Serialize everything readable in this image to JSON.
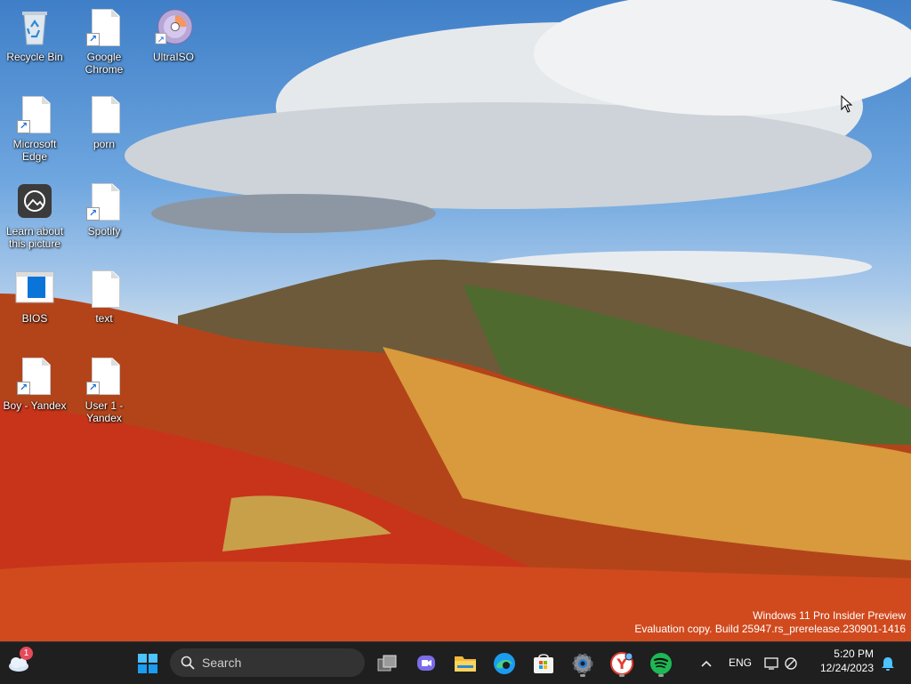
{
  "desktop": {
    "icons": [
      {
        "label": "Recycle Bin",
        "icon": "recycle-bin-icon"
      },
      {
        "label": "Google Chrome",
        "icon": "file-shortcut-icon"
      },
      {
        "label": "UltraISO",
        "icon": "disc-icon"
      },
      {
        "label": "Microsoft Edge",
        "icon": "file-shortcut-icon"
      },
      {
        "label": "porn",
        "icon": "file-icon"
      },
      {
        "label": "Learn about this picture",
        "icon": "camera-icon"
      },
      {
        "label": "Spotify",
        "icon": "file-shortcut-icon"
      },
      {
        "label": "BIOS",
        "icon": "bios-window-icon"
      },
      {
        "label": "text",
        "icon": "file-icon"
      },
      {
        "label": "Boy - Yandex",
        "icon": "file-shortcut-icon"
      },
      {
        "label": "User 1 - Yandex",
        "icon": "file-shortcut-icon"
      }
    ],
    "watermark": {
      "line1": "Windows 11 Pro Insider Preview",
      "line2": "Evaluation copy. Build 25947.rs_prerelease.230901-1416"
    }
  },
  "taskbar": {
    "weather_badge": "1",
    "search_placeholder": "Search",
    "apps": [
      "task-view",
      "teams-chat",
      "file-explorer",
      "edge",
      "store",
      "settings",
      "yandex-browser",
      "spotify"
    ],
    "language": "ENG",
    "time": "5:20 PM",
    "date": "12/24/2023"
  },
  "colors": {
    "taskbar_bg": "#1f1f1f",
    "accent_blue": "#0078d4",
    "spotify_green": "#1db954"
  }
}
